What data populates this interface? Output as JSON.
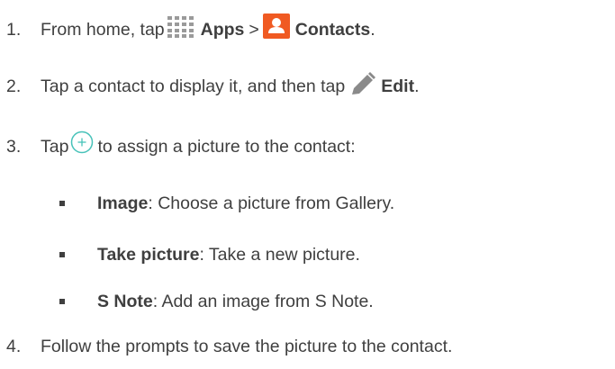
{
  "steps": [
    {
      "number": "1.",
      "pre": "From home, tap",
      "bold1": "Apps",
      "sep": ">",
      "bold2": "Contacts",
      "post": ".",
      "icons": [
        "apps-grid-icon",
        "contacts-icon"
      ]
    },
    {
      "number": "2.",
      "pre": "Tap a contact to display it, and then tap",
      "bold": "Edit",
      "post": ".",
      "icons": [
        "pencil-icon"
      ]
    },
    {
      "number": "3.",
      "pre": "Tap",
      "post": "to assign a picture to the contact:",
      "icons": [
        "add-circle-icon"
      ]
    },
    {
      "number": "4.",
      "text": "Follow the prompts to save the picture to the contact."
    }
  ],
  "options": [
    {
      "label": "Image",
      "desc": ": Choose a picture from Gallery."
    },
    {
      "label": "Take picture",
      "desc": ": Take a new picture."
    },
    {
      "label": "S Note",
      "desc": ": Add an image from S Note."
    }
  ],
  "colors": {
    "text": "#3f3f3f",
    "contacts_icon": "#f05a22",
    "apps_icon": "#9a9a9a",
    "pencil_icon": "#8a8a8a",
    "plus_icon": "#47c2b9"
  }
}
